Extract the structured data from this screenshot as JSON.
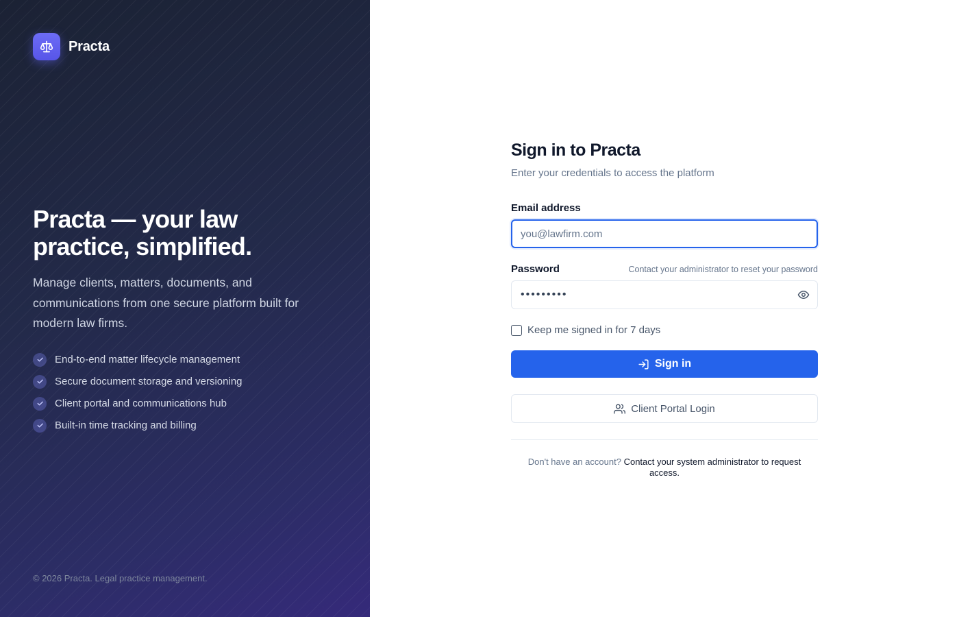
{
  "brand": {
    "name": "Practa",
    "logo_icon": "scale-icon",
    "logo_color": "#6366f1"
  },
  "hero": {
    "title_line1": "Practa — your law",
    "title_line2": "practice, simplified.",
    "description": "Manage clients, matters, documents, and communications from one secure platform built for modern law firms.",
    "features": [
      {
        "label": "End-to-end matter lifecycle management",
        "icon": "check-icon"
      },
      {
        "label": "Secure document storage and versioning",
        "icon": "check-icon"
      },
      {
        "label": "Client portal and communications hub",
        "icon": "check-icon"
      },
      {
        "label": "Built-in time tracking and billing",
        "icon": "check-icon"
      }
    ]
  },
  "footer": {
    "copyright": "© 2026 Practa. Legal practice management."
  },
  "signin": {
    "title": "Sign in to Practa",
    "subtitle": "Enter your credentials to access the platform",
    "email": {
      "label": "Email address",
      "placeholder": "you@lawfirm.com",
      "value": ""
    },
    "password": {
      "label": "Password",
      "hint": "Contact your administrator to reset your password",
      "value": "password1"
    },
    "remember": {
      "label": "Keep me signed in for 7 days",
      "checked": false
    },
    "submit_label": "Sign in",
    "client_portal_label": "Client Portal Login",
    "request": {
      "question": "Don't have an account?",
      "link_text": "Contact your system administrator to request access."
    }
  },
  "colors": {
    "primary": "#2563eb",
    "heading": "#0f172a",
    "muted": "#64748b",
    "panel_dark": "#1b2234",
    "panel_accent": "#352a7a"
  }
}
